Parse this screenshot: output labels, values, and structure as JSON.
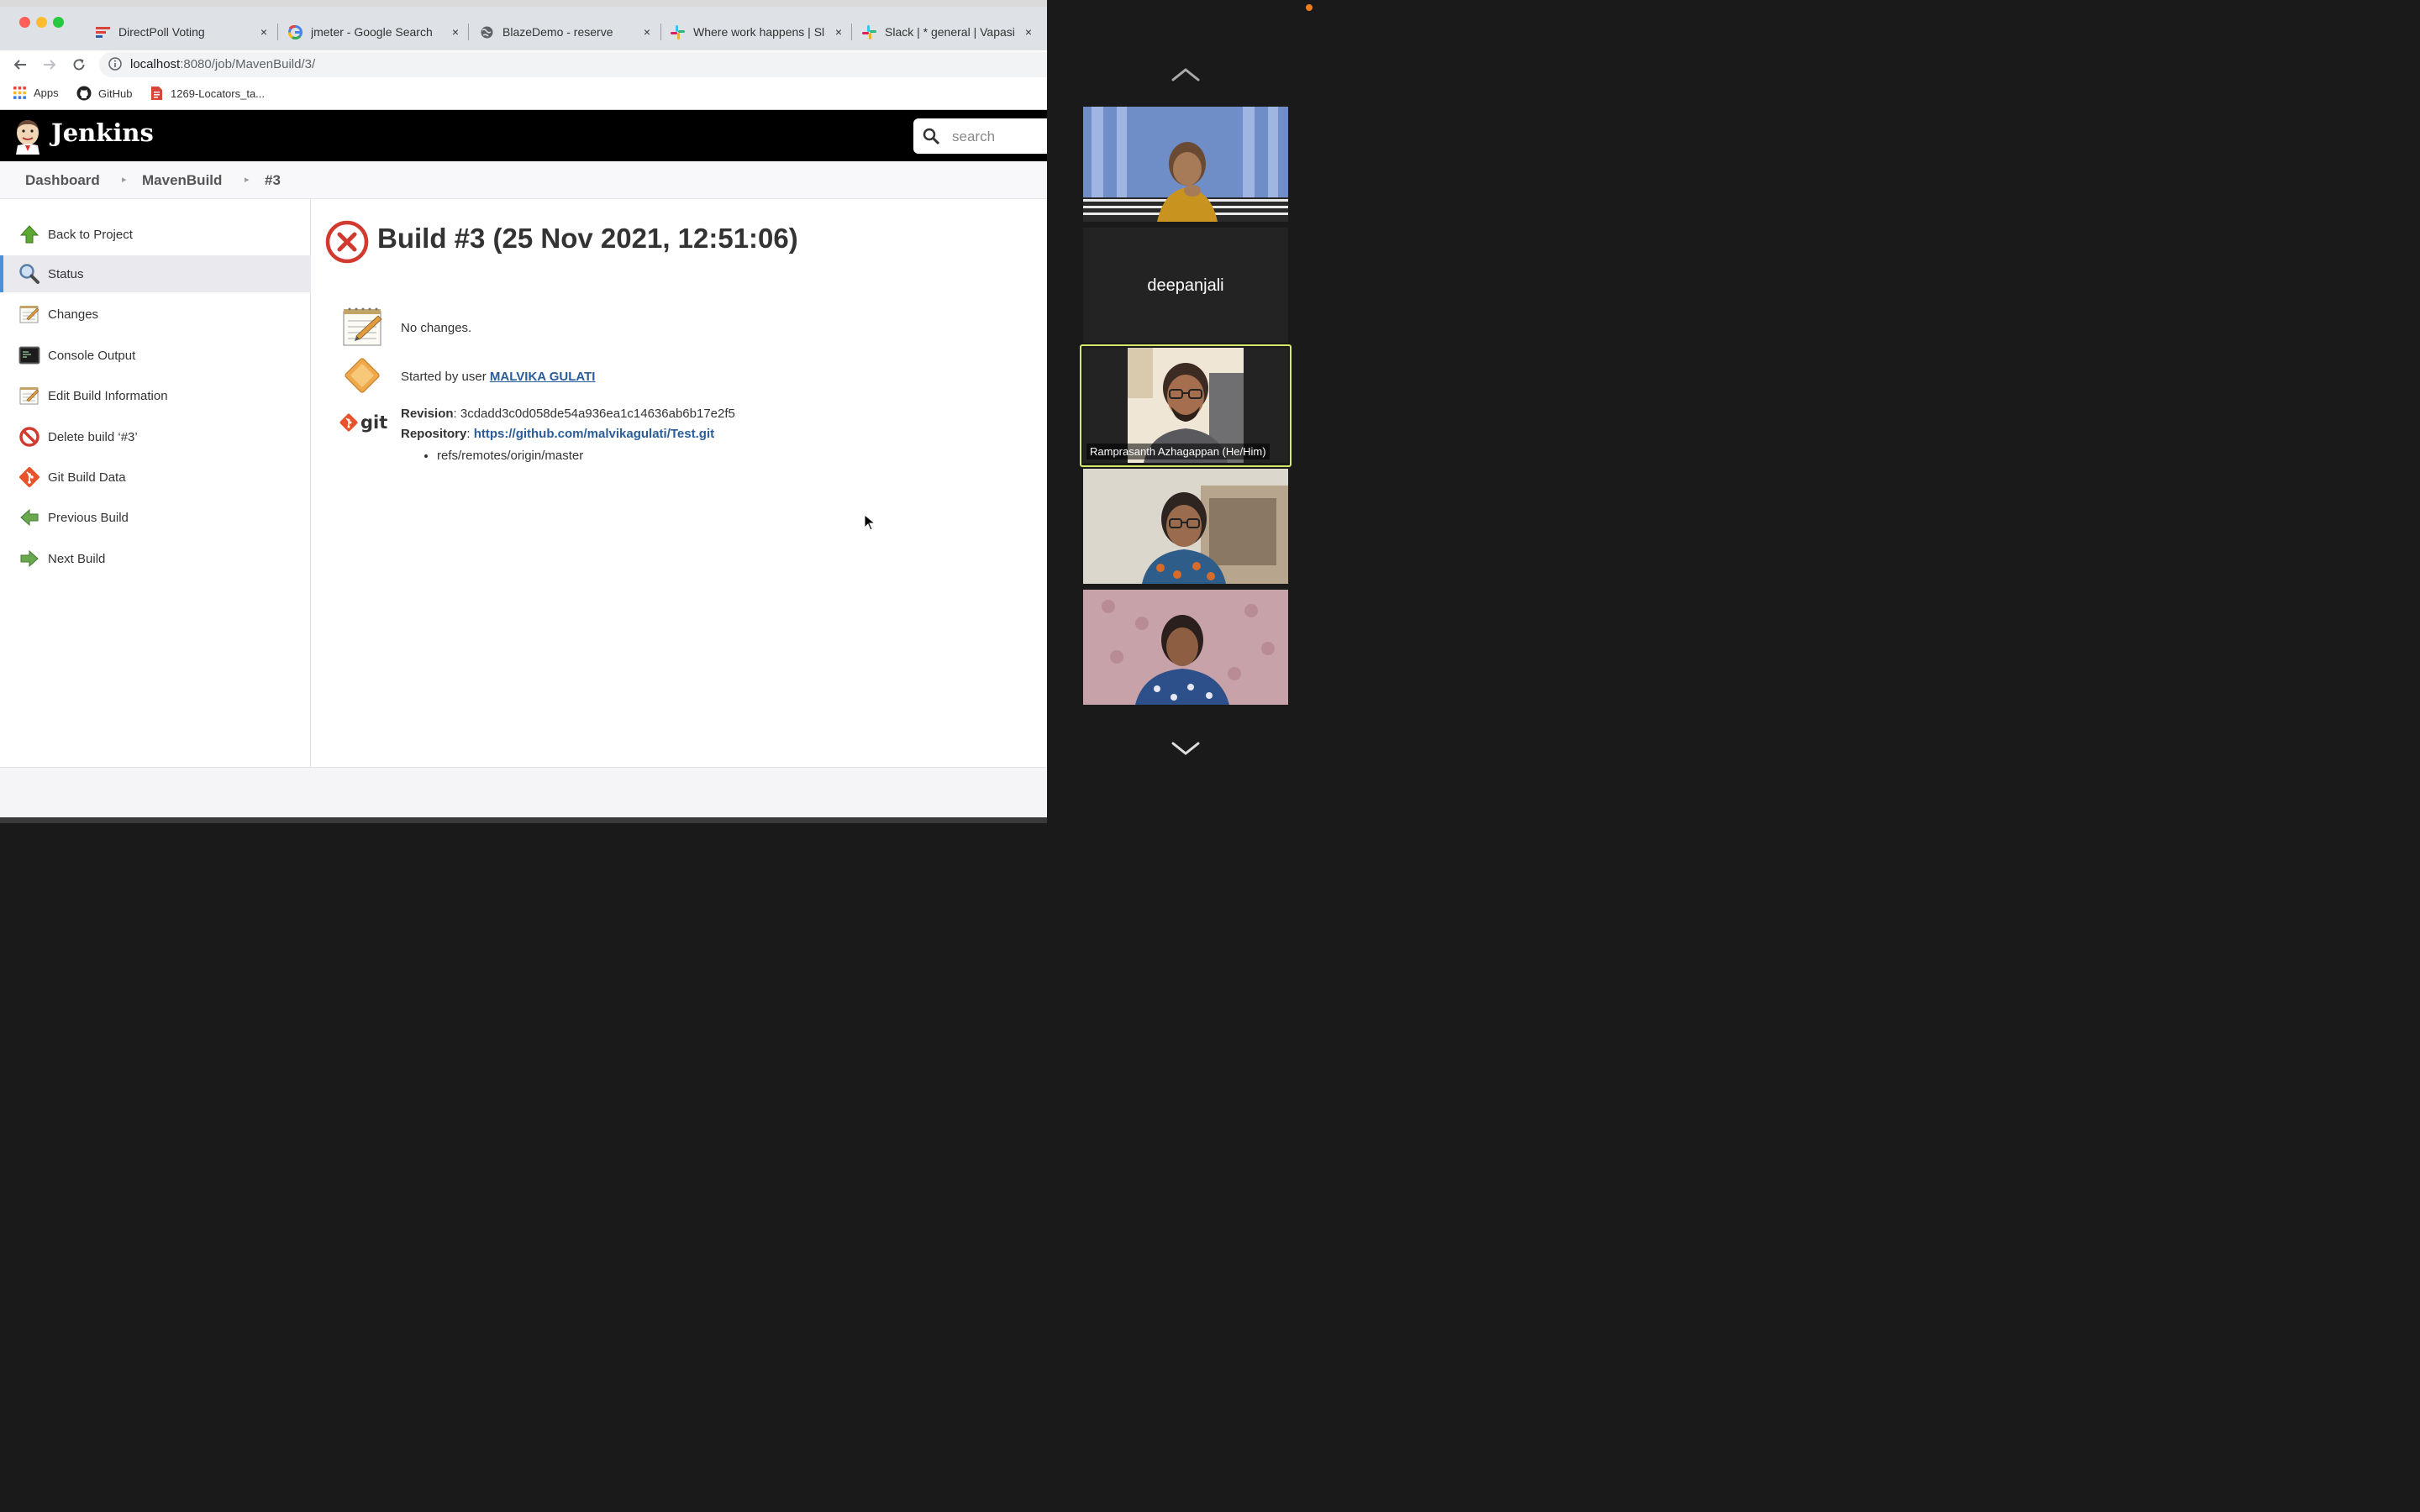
{
  "browser": {
    "tabs": [
      {
        "title": "DirectPoll Voting",
        "icon": "directpoll-icon"
      },
      {
        "title": "jmeter - Google Search",
        "icon": "google-icon"
      },
      {
        "title": "BlazeDemo - reserve",
        "icon": "globe-icon"
      },
      {
        "title": "Where work happens | Sl",
        "icon": "slack-icon"
      },
      {
        "title": "Slack | * general | Vapasi",
        "icon": "slack-icon"
      }
    ],
    "close_glyph": "×",
    "url_host": "localhost",
    "url_path": ":8080/job/MavenBuild/3/",
    "bookmarks": [
      {
        "label": "Apps",
        "icon": "apps-grid-icon"
      },
      {
        "label": "GitHub",
        "icon": "github-icon"
      },
      {
        "label": "1269-Locators_ta...",
        "icon": "document-icon"
      }
    ]
  },
  "jenkins": {
    "brand": "Jenkins",
    "search_placeholder": "search",
    "breadcrumbs": [
      "Dashboard",
      "MavenBuild",
      "#3"
    ],
    "sidebar": [
      {
        "label": "Back to Project",
        "icon": "up-arrow-icon",
        "active": false
      },
      {
        "label": "Status",
        "icon": "magnifier-icon",
        "active": true
      },
      {
        "label": "Changes",
        "icon": "notepad-icon",
        "active": false
      },
      {
        "label": "Console Output",
        "icon": "terminal-icon",
        "active": false
      },
      {
        "label": "Edit Build Information",
        "icon": "notepad-icon",
        "active": false
      },
      {
        "label": "Delete build ‘#3’",
        "icon": "no-entry-icon",
        "active": false
      },
      {
        "label": "Git Build Data",
        "icon": "git-icon",
        "active": false
      },
      {
        "label": "Previous Build",
        "icon": "left-arrow-icon",
        "active": false
      },
      {
        "label": "Next Build",
        "icon": "right-arrow-icon",
        "active": false
      }
    ],
    "build": {
      "title": "Build #3 (25 Nov 2021, 12:51:06)",
      "status": "failed",
      "no_changes": "No changes.",
      "started_by_prefix": "Started by user ",
      "started_by_user": "MALVIKA GULATI",
      "git_logo_text": "git",
      "revision_label": "Revision",
      "revision_value": "3cdadd3c0d058de54a936ea1c14636ab6b17e2f5",
      "repository_label": "Repository",
      "repository_url": "https://github.com/malvikagulati/Test.git",
      "branches": [
        "refs/remotes/origin/master"
      ]
    }
  },
  "video_call": {
    "participants": [
      {
        "name": "",
        "video": true
      },
      {
        "name": "deepanjali",
        "video": false
      },
      {
        "name": "Ramprasanth Azhagappan (He/Him)",
        "video": true,
        "active_speaker": true
      },
      {
        "name": "",
        "video": true
      },
      {
        "name": "",
        "video": true
      }
    ]
  }
}
